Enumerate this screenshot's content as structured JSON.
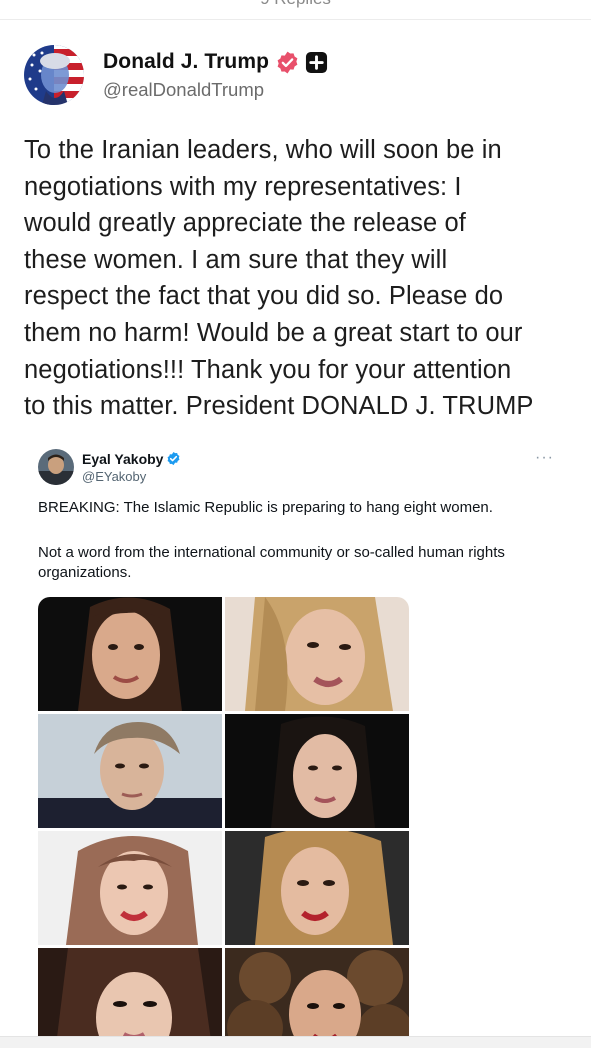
{
  "top": {
    "replies_label": "9 Replies"
  },
  "post": {
    "display_name": "Donald J. Trump",
    "handle": "@realDonaldTrump",
    "verified_badge_color": "#e8506b",
    "text": "To the Iranian leaders, who will soon be in\nnegotiations with my representatives: I\nwould greatly appreciate the release of\nthese women. I am sure that they will\nrespect the fact that you did so. Please do\nthem no harm! Would be a great start to our\nnegotiations!!! Thank you for your attention\nto this matter. President DONALD J. TRUMP"
  },
  "embedded_post": {
    "display_name": "Eyal Yakoby",
    "handle": "@EYakoby",
    "more_label": "···",
    "verified_badge_color": "#1d9bf0",
    "text_1": "BREAKING: The Islamic Republic is preparing to hang eight women.",
    "text_2": "Not a word from the international community or so-called human rights organizations.",
    "photo_count": 8
  },
  "icons": {
    "verified": "verified-badge-icon",
    "plus": "plus-square-icon",
    "more": "more-horizontal-icon"
  }
}
